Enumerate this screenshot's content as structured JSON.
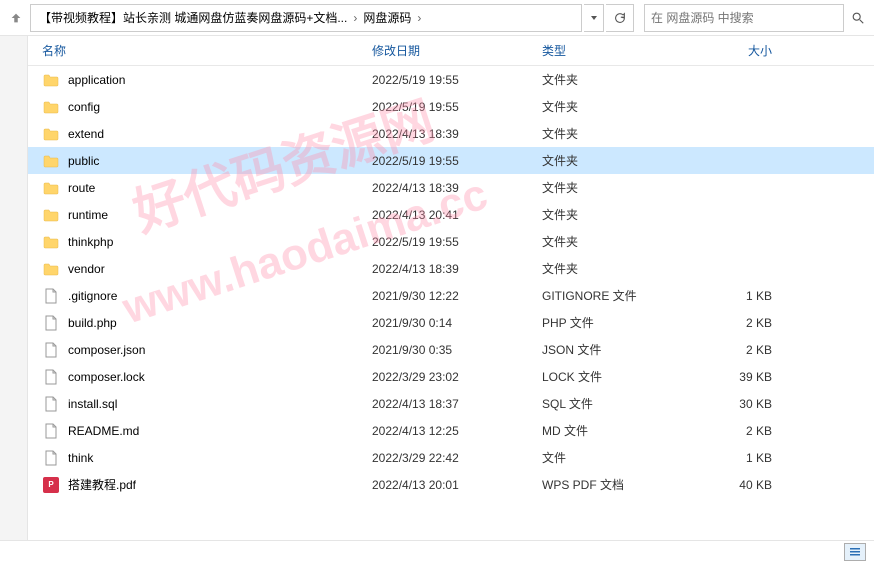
{
  "breadcrumb": {
    "seg1": "【带视频教程】站长亲测 城通网盘仿蓝奏网盘源码+文档...",
    "seg2": "网盘源码"
  },
  "search": {
    "placeholder": "在 网盘源码 中搜索"
  },
  "columns": {
    "name": "名称",
    "date": "修改日期",
    "type": "类型",
    "size": "大小"
  },
  "watermark": {
    "line1": "好代码资源网",
    "line2": "www.haodaima.cc"
  },
  "rows": [
    {
      "icon": "folder",
      "name": "application",
      "date": "2022/5/19 19:55",
      "type": "文件夹",
      "size": ""
    },
    {
      "icon": "folder",
      "name": "config",
      "date": "2022/5/19 19:55",
      "type": "文件夹",
      "size": ""
    },
    {
      "icon": "folder",
      "name": "extend",
      "date": "2022/4/13 18:39",
      "type": "文件夹",
      "size": ""
    },
    {
      "icon": "folder",
      "name": "public",
      "date": "2022/5/19 19:55",
      "type": "文件夹",
      "size": "",
      "selected": true
    },
    {
      "icon": "folder",
      "name": "route",
      "date": "2022/4/13 18:39",
      "type": "文件夹",
      "size": ""
    },
    {
      "icon": "folder",
      "name": "runtime",
      "date": "2022/4/13 20:41",
      "type": "文件夹",
      "size": ""
    },
    {
      "icon": "folder",
      "name": "thinkphp",
      "date": "2022/5/19 19:55",
      "type": "文件夹",
      "size": ""
    },
    {
      "icon": "folder",
      "name": "vendor",
      "date": "2022/4/13 18:39",
      "type": "文件夹",
      "size": ""
    },
    {
      "icon": "file",
      "name": ".gitignore",
      "date": "2021/9/30 12:22",
      "type": "GITIGNORE 文件",
      "size": "1 KB"
    },
    {
      "icon": "file",
      "name": "build.php",
      "date": "2021/9/30 0:14",
      "type": "PHP 文件",
      "size": "2 KB"
    },
    {
      "icon": "file",
      "name": "composer.json",
      "date": "2021/9/30 0:35",
      "type": "JSON 文件",
      "size": "2 KB"
    },
    {
      "icon": "file",
      "name": "composer.lock",
      "date": "2022/3/29 23:02",
      "type": "LOCK 文件",
      "size": "39 KB"
    },
    {
      "icon": "file",
      "name": "install.sql",
      "date": "2022/4/13 18:37",
      "type": "SQL 文件",
      "size": "30 KB"
    },
    {
      "icon": "file",
      "name": "README.md",
      "date": "2022/4/13 12:25",
      "type": "MD 文件",
      "size": "2 KB"
    },
    {
      "icon": "file",
      "name": "think",
      "date": "2022/3/29 22:42",
      "type": "文件",
      "size": "1 KB"
    },
    {
      "icon": "pdf",
      "name": "搭建教程.pdf",
      "date": "2022/4/13 20:01",
      "type": "WPS PDF 文档",
      "size": "40 KB"
    }
  ]
}
